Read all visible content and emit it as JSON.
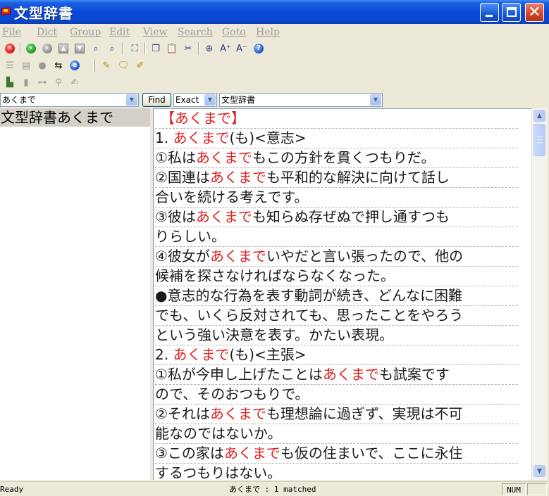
{
  "window": {
    "title": "文型辞書"
  },
  "menu": [
    "File",
    "Dict",
    "Group",
    "Edit",
    "View",
    "Search",
    "Goto",
    "Help"
  ],
  "toolbar1": [
    "stop-icon",
    "back-icon",
    "forward-icon",
    "up-icon",
    "down-icon",
    "search-icon",
    "search-next-icon",
    "fullscreen-icon",
    "copy-icon",
    "paste-icon",
    "cut-icon",
    "zoom-icon",
    "font-increase-icon",
    "font-decrease-icon",
    "help-icon"
  ],
  "toolbar2": [
    "list-icon",
    "card-icon",
    "speech-icon",
    "navigate-icon",
    "web-icon",
    "highlight-icon",
    "note-icon",
    "edit-pen-icon"
  ],
  "toolbar3": [
    "bookmark-icon",
    "document-icon",
    "tree-icon",
    "pin-icon",
    "write-icon"
  ],
  "search": {
    "query": "あくまで",
    "find_label": "Find",
    "mode": "Exact",
    "dictionary": "文型辞書"
  },
  "results": {
    "items": [
      "文型辞書あくまで"
    ]
  },
  "entry": {
    "lines": [
      [
        {
          "t": "【あくまで】",
          "red": true
        }
      ],
      [
        {
          "t": "1.  "
        },
        {
          "t": "あくまで",
          "red": true
        },
        {
          "t": "(も)<意志>"
        }
      ],
      [
        {
          "t": "①私は"
        },
        {
          "t": "あくまで",
          "red": true
        },
        {
          "t": "もこの方針を貫くつもりだ。"
        }
      ],
      [
        {
          "t": "②国連は"
        },
        {
          "t": "あくまで",
          "red": true
        },
        {
          "t": "も平和的な解決に向けて話し"
        }
      ],
      [
        {
          "t": "合いを続ける考えです。"
        }
      ],
      [
        {
          "t": "③彼は"
        },
        {
          "t": "あくまで",
          "red": true
        },
        {
          "t": "も知らぬ存ぜぬで押し通すつも"
        }
      ],
      [
        {
          "t": "りらしい。"
        }
      ],
      [
        {
          "t": "④彼女が"
        },
        {
          "t": "あくまで",
          "red": true
        },
        {
          "t": "いやだと言い張ったので、他の"
        }
      ],
      [
        {
          "t": "候補を探さなければならなくなった。"
        }
      ],
      [
        {
          "t": "●意志的な行為を表す動詞が続き、どんなに困難"
        }
      ],
      [
        {
          "t": "でも、いくら反対されても、思ったことをやろう"
        }
      ],
      [
        {
          "t": "という強い決意を表す。かたい表現。"
        }
      ],
      [
        {
          "t": "2.  "
        },
        {
          "t": "あくまで",
          "red": true
        },
        {
          "t": "(も)<主張>"
        }
      ],
      [
        {
          "t": "①私が今申し上げたことは"
        },
        {
          "t": "あくまで",
          "red": true
        },
        {
          "t": "も試案です"
        }
      ],
      [
        {
          "t": "ので、そのおつもりで。"
        }
      ],
      [
        {
          "t": "②それは"
        },
        {
          "t": "あくまで",
          "red": true
        },
        {
          "t": "も理想論に過ぎず、実現は不可"
        }
      ],
      [
        {
          "t": "能なのではないか。"
        }
      ],
      [
        {
          "t": "③この家は"
        },
        {
          "t": "あくまで",
          "red": true
        },
        {
          "t": "も仮の住まいで、ここに永住"
        }
      ],
      [
        {
          "t": "するつもりはない。"
        }
      ]
    ]
  },
  "status": {
    "left": "Ready",
    "middle": "あくまで : 1 matched",
    "num": "NUM"
  }
}
